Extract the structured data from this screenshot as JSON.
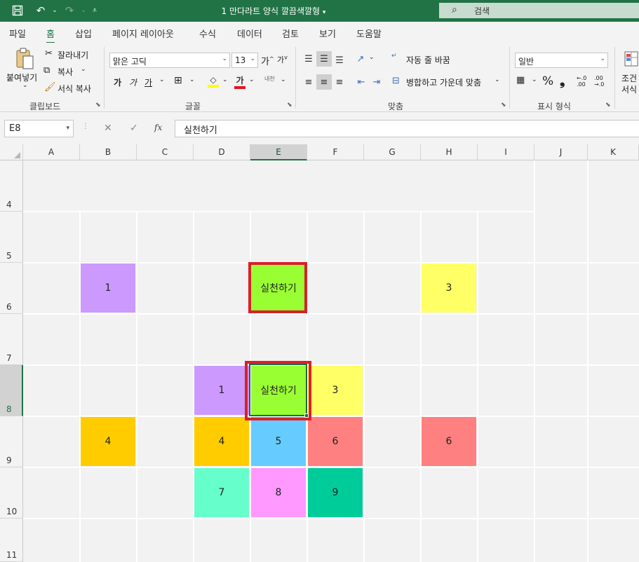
{
  "titlebar": {
    "doc_title": "1 만다라트 양식 깔끔색깔형",
    "title_caret": "▾",
    "search_placeholder": "검색"
  },
  "tabs": [
    "파일",
    "홈",
    "삽입",
    "페이지 레이아웃",
    "수식",
    "데이터",
    "검토",
    "보기",
    "도움말"
  ],
  "active_tab": "홈",
  "ribbon": {
    "clipboard": {
      "paste": "붙여넣기",
      "cut": "잘라내기",
      "copy": "복사",
      "format_painter": "서식 복사",
      "label": "클립보드"
    },
    "font": {
      "name": "맑은 고딕",
      "size": "13",
      "grow": "가",
      "shrink": "가",
      "bold": "가",
      "italic": "가",
      "underline": "가",
      "font_color_glyph": "가",
      "phonetic": "내천",
      "label": "글꼴"
    },
    "alignment": {
      "wrap_text": "자동 줄 바꿈",
      "merge_center": "병합하고 가운데 맞춤",
      "label": "맞춤"
    },
    "number": {
      "format": "일반",
      "percent": "%",
      "comma": "❟",
      "inc_decimal": "←.0 .00",
      "dec_decimal": ".00 →.0",
      "label": "표시 형식"
    },
    "styles": {
      "conditional_line1": "조건",
      "conditional_line2": "서식"
    }
  },
  "formula_bar": {
    "name_box": "E8",
    "fx": "fx",
    "value": "실천하기"
  },
  "columns": [
    "A",
    "B",
    "C",
    "D",
    "E",
    "F",
    "G",
    "H",
    "I",
    "J",
    "K"
  ],
  "selected_column": "E",
  "rows": [
    "4",
    "5",
    "6",
    "7",
    "8",
    "9",
    "10",
    "11"
  ],
  "selected_row": "8",
  "cells": {
    "B6": "1",
    "E6": "실천하기",
    "H6": "3",
    "D8": "1",
    "E8": "실천하기",
    "F8": "3",
    "B9": "4",
    "D9": "4",
    "E9": "5",
    "F9": "6",
    "H9": "6",
    "D10": "7",
    "E10": "8",
    "F10": "9"
  },
  "colors": {
    "excel_green": "#217346",
    "highlight_red": "#d9202a",
    "purple": "#cc99ff",
    "lime": "#99ff33",
    "yellow": "#ffff66",
    "orange": "#ffcc00",
    "blue": "#66ccff",
    "salmon": "#ff8080",
    "mint": "#66ffcc",
    "pink": "#ff99ff",
    "teal": "#00cc99"
  }
}
